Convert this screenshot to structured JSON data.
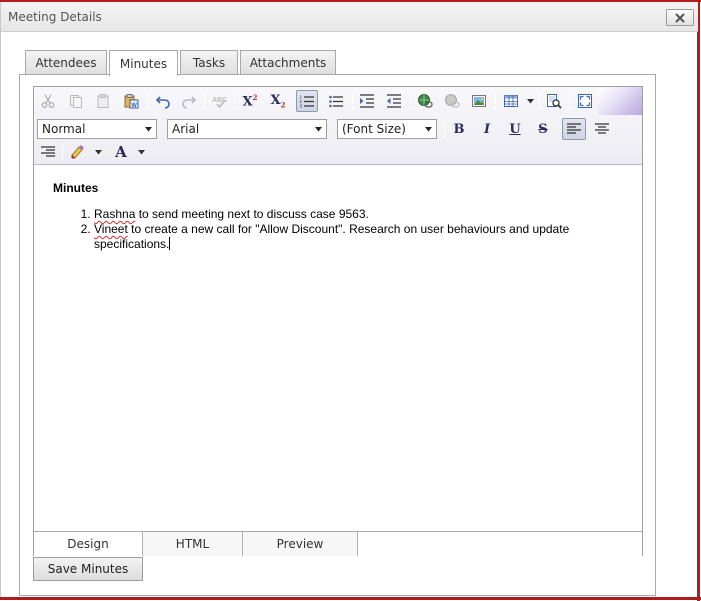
{
  "dialog": {
    "title": "Meeting Details"
  },
  "tabs": [
    {
      "label": "Attendees"
    },
    {
      "label": "Minutes"
    },
    {
      "label": "Tasks"
    },
    {
      "label": "Attachments"
    }
  ],
  "editor": {
    "paragraph_format": "Normal",
    "font_name": "Arial",
    "font_size": "(Font Size)",
    "toolbar_letters": {
      "superscript": "X",
      "subscript": "X",
      "bold": "B",
      "italic": "I",
      "underline": "U",
      "strike": "S",
      "fore_color": "A"
    },
    "content": {
      "heading": "Minutes",
      "items": [
        {
          "name": "Rashna",
          "text": " to send meeting next to discuss case 9563."
        },
        {
          "name": "Vineet",
          "text": " to create a new call for \"Allow Discount\". Research on user behaviours and update specifications."
        }
      ]
    },
    "modes": [
      {
        "label": "Design"
      },
      {
        "label": "HTML"
      },
      {
        "label": "Preview"
      }
    ]
  },
  "actions": {
    "save_label": "Save Minutes"
  },
  "colors": {
    "frame_red": "#b01b1b",
    "toolbar_bg": "#ececf2",
    "text_link_dark": "#2b2b5a"
  }
}
